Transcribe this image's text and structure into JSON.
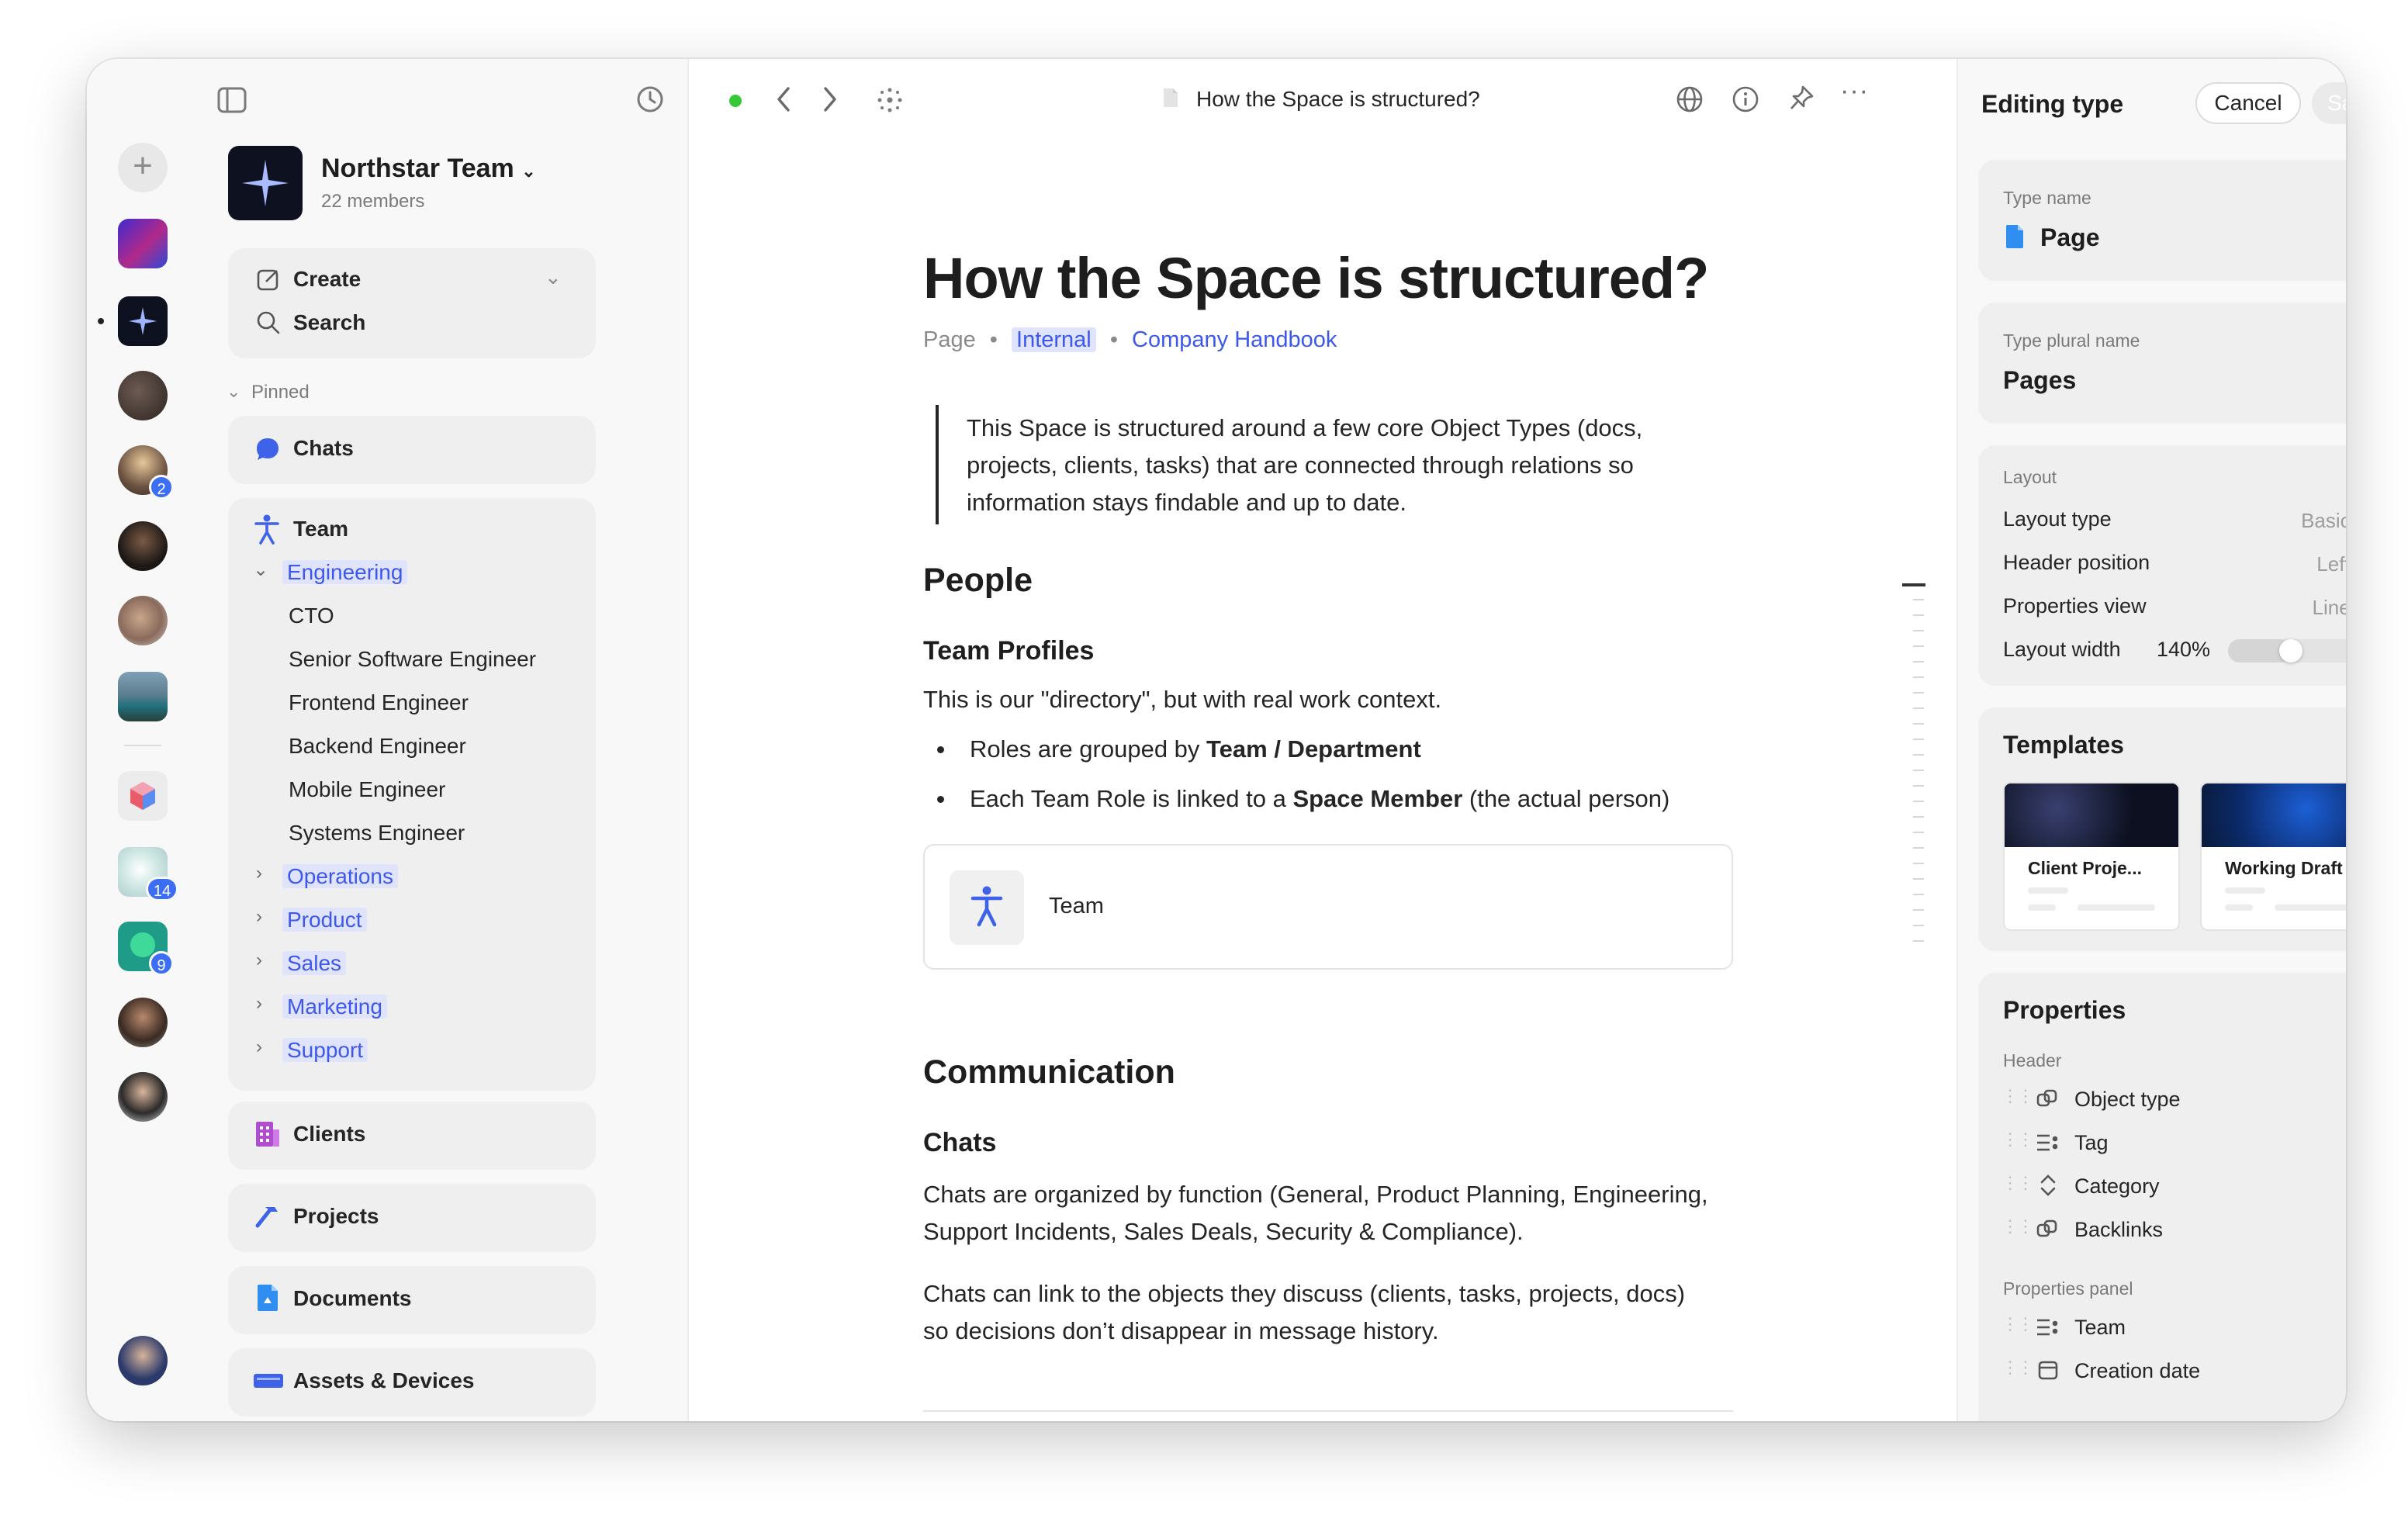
{
  "window": {
    "title": "How the Space is structured?"
  },
  "rail": {
    "add_label": "+",
    "workspaces": [
      {
        "name": "gradient-workspace"
      },
      {
        "name": "northstar-workspace"
      },
      {
        "name": "dark-space"
      },
      {
        "name": "user-blonde",
        "badge": "2"
      },
      {
        "name": "user-dark"
      },
      {
        "name": "user-photo"
      },
      {
        "name": "lake-workspace"
      },
      {
        "name": "cube-workspace"
      },
      {
        "name": "glow-workspace",
        "badge": "14"
      },
      {
        "name": "green-workspace",
        "badge": "9"
      },
      {
        "name": "user-beard"
      },
      {
        "name": "user-glasses"
      }
    ]
  },
  "sidebar": {
    "team_name": "Northstar Team",
    "members": "22 members",
    "create": "Create",
    "search": "Search",
    "pinned": "Pinned",
    "chats": "Chats",
    "team": "Team",
    "engineering": "Engineering",
    "engineering_items": [
      "CTO",
      "Senior Software Engineer",
      "Frontend Engineer",
      "Backend Engineer",
      "Mobile Engineer",
      "Systems Engineer"
    ],
    "groups": [
      "Operations",
      "Product",
      "Sales",
      "Marketing",
      "Support"
    ],
    "clients": "Clients",
    "projects": "Projects",
    "documents": "Documents",
    "assets": "Assets & Devices"
  },
  "toolbar": {
    "title": "How the Space is structured?"
  },
  "doc": {
    "title": "How the Space is structured?",
    "meta_type": "Page",
    "meta_tag": "Internal",
    "meta_link": "Company Handbook",
    "quote": "This Space is structured around a few core Object Types (docs, projects, clients, tasks) that are connected through relations so information stays findable and up to date.",
    "h_people": "People",
    "h_team_profiles": "Team Profiles",
    "p_directory": "This is our \"directory\", but with real work context.",
    "bullet1_pre": "Roles are grouped by ",
    "bullet1_bold": "Team / Department",
    "bullet2_pre": "Each Team Role is linked to a ",
    "bullet2_bold": "Space Member",
    "bullet2_post": " (the actual person)",
    "embed_label": "Team",
    "h_communication": "Communication",
    "h_chats": "Chats",
    "p_chats1": "Chats are organized by function (General, Product Planning, Engineering, Support Incidents, Sales Deals, Security & Compliance).",
    "p_chats2": "Chats can link to the objects they discuss (clients, tasks, projects, docs) so decisions don’t disappear in message history."
  },
  "panel": {
    "title": "Editing type",
    "cancel": "Cancel",
    "save": "Save",
    "type_name_label": "Type name",
    "type_name": "Page",
    "plural_label": "Type plural name",
    "plural": "Pages",
    "layout_label": "Layout",
    "layout_type": "Layout type",
    "layout_type_val": "Basic",
    "header_position": "Header position",
    "header_position_val": "Left",
    "properties_view": "Properties view",
    "properties_view_val": "Line",
    "layout_width": "Layout width",
    "layout_width_val": "140%",
    "layout_width_fraction": 0.4,
    "templates": "Templates",
    "template1": "Client Proje...",
    "template2": "Working Draft",
    "properties": "Properties",
    "header": "Header",
    "header_props": [
      "Object type",
      "Tag",
      "Category",
      "Backlinks"
    ],
    "properties_panel": "Properties panel",
    "panel_props": [
      "Team",
      "Creation date"
    ]
  }
}
